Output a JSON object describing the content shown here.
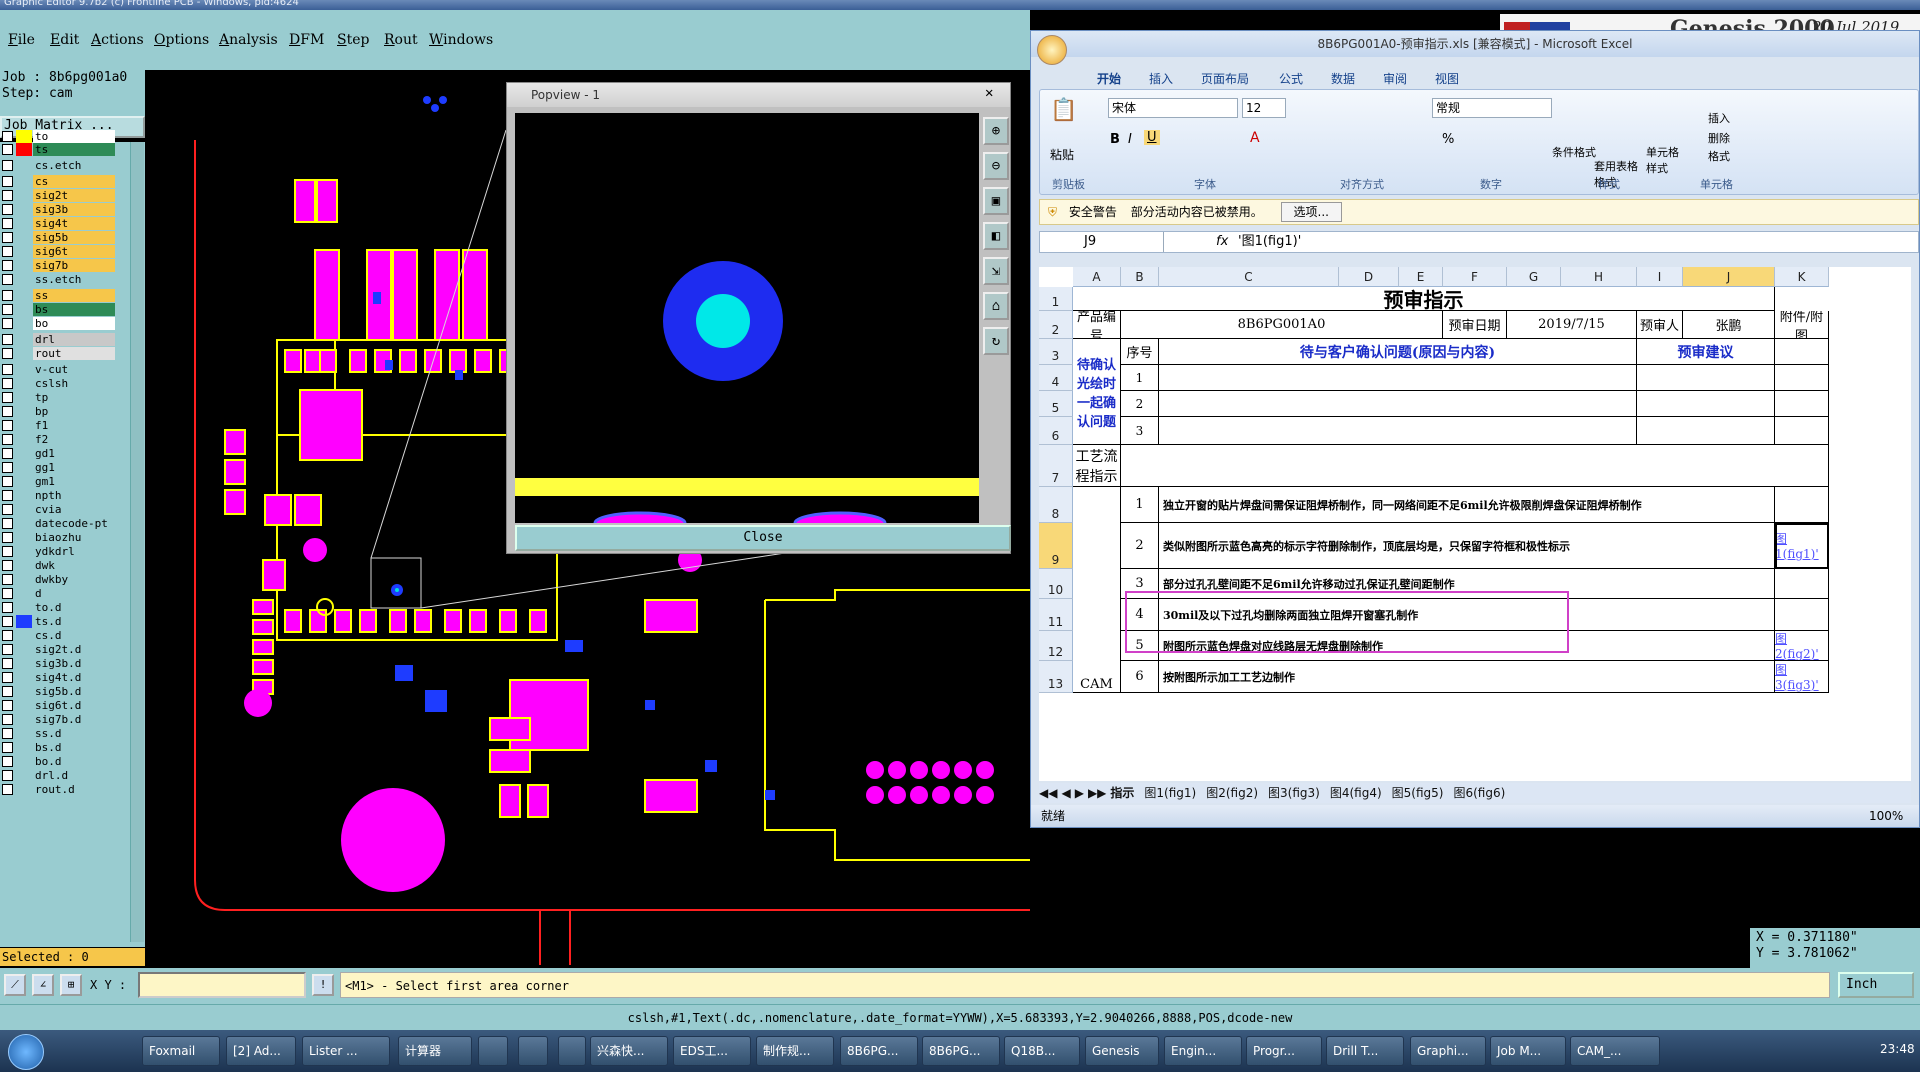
{
  "window_title": "Graphic Editor 9.7b2 (c) Frontline PCB - Windows, pid:4624",
  "menu": [
    "File",
    "Edit",
    "Actions",
    "Options",
    "Analysis",
    "DFM",
    "Step",
    "Rout",
    "Windows"
  ],
  "job": {
    "job_line": "Job : 8b6pg001a0",
    "step_line": "Step: cam",
    "matrix_btn": "Job Matrix ..."
  },
  "layers": [
    {
      "name": "to",
      "color": "#ffff00",
      "sel": "#ffffff"
    },
    {
      "name": "ts",
      "color": "#ff0000",
      "sel": "#2e8b57"
    },
    {
      "name": "cs.etch",
      "color": "",
      "sel": "#99ccd0"
    },
    {
      "name": "cs",
      "color": "",
      "sel": "#f6c64a"
    },
    {
      "name": "sig2t",
      "color": "",
      "sel": "#f6c64a"
    },
    {
      "name": "sig3b",
      "color": "",
      "sel": "#f6c64a"
    },
    {
      "name": "sig4t",
      "color": "",
      "sel": "#f6c64a"
    },
    {
      "name": "sig5b",
      "color": "",
      "sel": "#f6c64a"
    },
    {
      "name": "sig6t",
      "color": "",
      "sel": "#f6c64a"
    },
    {
      "name": "sig7b",
      "color": "",
      "sel": "#f6c64a"
    },
    {
      "name": "ss.etch",
      "color": "",
      "sel": "#99ccd0"
    },
    {
      "name": "ss",
      "color": "",
      "sel": "#f6c64a"
    },
    {
      "name": "bs",
      "color": "",
      "sel": "#2e8b57"
    },
    {
      "name": "bo",
      "color": "",
      "sel": "#ffffff"
    },
    {
      "name": "drl",
      "color": "",
      "sel": "#c8c8c8"
    },
    {
      "name": "rout",
      "color": "",
      "sel": "#e0e0e0"
    },
    {
      "name": "v-cut",
      "color": "",
      "sel": "#99ccd0"
    },
    {
      "name": "cslsh",
      "color": "",
      "sel": "#99ccd0"
    },
    {
      "name": "tp",
      "color": "",
      "sel": "#99ccd0"
    },
    {
      "name": "bp",
      "color": "",
      "sel": "#99ccd0"
    },
    {
      "name": "f1",
      "color": "",
      "sel": "#99ccd0"
    },
    {
      "name": "f2",
      "color": "",
      "sel": "#99ccd0"
    },
    {
      "name": "gd1",
      "color": "",
      "sel": "#99ccd0"
    },
    {
      "name": "gg1",
      "color": "",
      "sel": "#99ccd0"
    },
    {
      "name": "gm1",
      "color": "",
      "sel": "#99ccd0"
    },
    {
      "name": "npth",
      "color": "",
      "sel": "#99ccd0"
    },
    {
      "name": "cvia",
      "color": "",
      "sel": "#99ccd0"
    },
    {
      "name": "datecode-pt",
      "color": "",
      "sel": "#99ccd0"
    },
    {
      "name": "biaozhu",
      "color": "",
      "sel": "#99ccd0"
    },
    {
      "name": "ydkdrl",
      "color": "",
      "sel": "#99ccd0"
    },
    {
      "name": "dwk",
      "color": "",
      "sel": "#99ccd0"
    },
    {
      "name": "dwkby",
      "color": "",
      "sel": "#99ccd0"
    },
    {
      "name": "d",
      "color": "",
      "sel": "#99ccd0"
    },
    {
      "name": "to.d",
      "color": "",
      "sel": "#99ccd0"
    },
    {
      "name": "ts.d",
      "color": "#1e3cff",
      "sel": "#99ccd0"
    },
    {
      "name": "cs.d",
      "color": "",
      "sel": "#99ccd0"
    },
    {
      "name": "sig2t.d",
      "color": "",
      "sel": "#99ccd0"
    },
    {
      "name": "sig3b.d",
      "color": "",
      "sel": "#99ccd0"
    },
    {
      "name": "sig4t.d",
      "color": "",
      "sel": "#99ccd0"
    },
    {
      "name": "sig5b.d",
      "color": "",
      "sel": "#99ccd0"
    },
    {
      "name": "sig6t.d",
      "color": "",
      "sel": "#99ccd0"
    },
    {
      "name": "sig7b.d",
      "color": "",
      "sel": "#99ccd0"
    },
    {
      "name": "ss.d",
      "color": "",
      "sel": "#99ccd0"
    },
    {
      "name": "bs.d",
      "color": "",
      "sel": "#99ccd0"
    },
    {
      "name": "bo.d",
      "color": "",
      "sel": "#99ccd0"
    },
    {
      "name": "drl.d",
      "color": "",
      "sel": "#99ccd0"
    },
    {
      "name": "rout.d",
      "color": "",
      "sel": "#99ccd0"
    }
  ],
  "selected": "Selected : 0",
  "popview": {
    "title": "Popview - 1",
    "close": "Close"
  },
  "excel": {
    "title": "8B6PG001A0-预审指示.xls [兼容模式] - Microsoft Excel",
    "tabs": [
      "开始",
      "插入",
      "页面布局",
      "公式",
      "数据",
      "审阅",
      "视图"
    ],
    "groups": [
      "剪贴板",
      "字体",
      "对齐方式",
      "数字",
      "样式",
      "单元格"
    ],
    "font_name": "宋体",
    "font_size": "12",
    "number_format": "常规",
    "ribbon_labels": [
      "粘贴",
      "条件格式",
      "套用表格格式",
      "单元格样式",
      "插入",
      "删除",
      "格式"
    ],
    "security_label": "安全警告",
    "security_text": "部分活动内容已被禁用。",
    "options_btn": "选项...",
    "cell_ref": "J9",
    "formula": "'图1(fig1)'",
    "columns": [
      "A",
      "B",
      "C",
      "D",
      "E",
      "F",
      "G",
      "H",
      "I",
      "J",
      "K"
    ],
    "rows": [
      "1",
      "2",
      "3",
      "4",
      "5",
      "6",
      "7",
      "8",
      "9",
      "10",
      "11",
      "12",
      "13"
    ],
    "sheet_title": "预审指示",
    "product_label": "产品编号",
    "product_value": "8B6PG001A0",
    "date_label": "预审日期",
    "date_value": "2019/7/15",
    "reviewer_label": "预审人",
    "reviewer_value": "张鹏",
    "attach_label": "附件/附图",
    "seq_label": "序号",
    "issue_header": "待与客户确认问题(原因与内容)",
    "advice_header": "预审建议",
    "pending_label": "待确认光绘时一起确认问题",
    "process_label": "工艺流程指示",
    "cam_label": "CAM",
    "items": [
      {
        "n": "1",
        "text": "独立开窗的贴片焊盘间需保证阻焊桥制作，同一网络间距不足6mil允许极限削焊盘保证阻焊桥制作",
        "link": ""
      },
      {
        "n": "2",
        "text": "类似附图所示蓝色高亮的标示字符删除制作，顶底层均是，只保留字符框和极性标示",
        "link": "图1(fig1)'"
      },
      {
        "n": "3",
        "text": "部分过孔孔壁间距不足6mil允许移动过孔保证孔壁间距制作",
        "link": ""
      },
      {
        "n": "4",
        "text": "30mil及以下过孔均删除两面独立阻焊开窗塞孔制作",
        "link": ""
      },
      {
        "n": "5",
        "text": "附图所示蓝色焊盘对应线路层无焊盘删除制作",
        "link": "图2(fig2)'"
      },
      {
        "n": "6",
        "text": "按附图所示加工工艺边制作",
        "link": "图3(fig3)'"
      }
    ],
    "sheet_tabs": [
      "指示",
      "图1(fig1)",
      "图2(fig2)",
      "图3(fig3)",
      "图4(fig4)",
      "图5(fig5)",
      "图6(fig6)"
    ],
    "status": "就绪",
    "zoom": "100%"
  },
  "genesis": {
    "brand": "Genesis 2000",
    "date": "20 Jul 2019"
  },
  "coords": {
    "x": "X = 0.371180\"",
    "y": "Y = 3.781062\""
  },
  "cmd": {
    "xy_label": "X Y :",
    "prompt": "<M1> - Select first area corner",
    "unit": "Inch"
  },
  "statusline": "cslsh,#1,Text(.dc,.nomenclature,.date_format=YYWW),X=5.683393,Y=2.9040266,8888,POS,dcode-new",
  "taskbar": [
    "Foxmail",
    "[2] Ad...",
    "Lister ...",
    "计算器",
    "",
    "",
    "",
    "兴森快...",
    "EDS工...",
    "制作规...",
    "8B6PG...",
    "8B6PG...",
    "Q18B...",
    "Genesis",
    "Engin...",
    "Progr...",
    "Drill T...",
    "Graphi...",
    "Job M...",
    "CAM_..."
  ],
  "clock": "23:48"
}
